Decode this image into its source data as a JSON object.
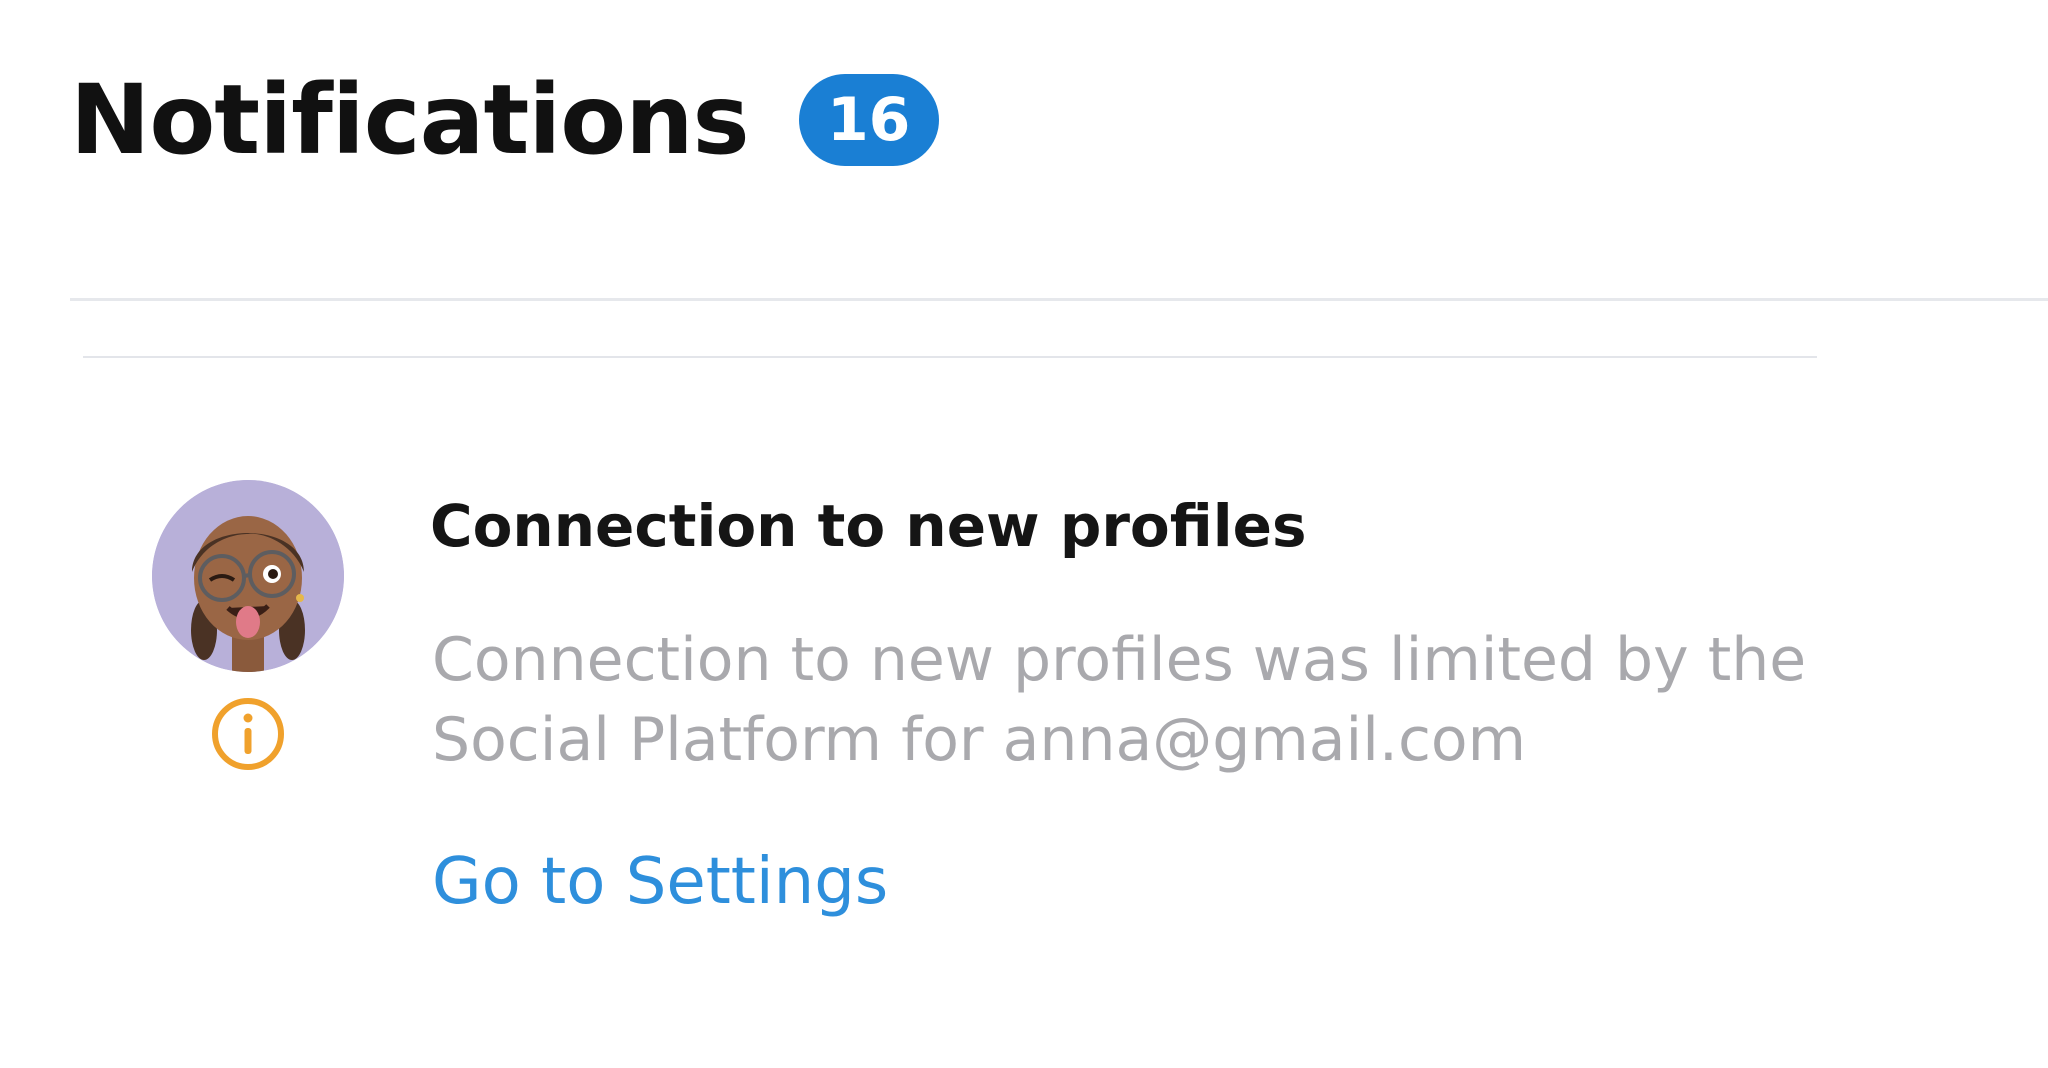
{
  "header": {
    "title": "Notifications",
    "count": "16"
  },
  "notification": {
    "title": "Connection to new profiles",
    "body": "Connection to new profiles was limited by the Social Platform for anna@gmail.com",
    "action_label": "Go to Settings",
    "avatar_icon": "memoji-avatar",
    "status_icon": "info-icon"
  },
  "colors": {
    "badge": "#1a7fd4",
    "link": "#2e8fdc",
    "info_icon": "#f0a12c",
    "avatar_bg": "#b8b0d9"
  }
}
